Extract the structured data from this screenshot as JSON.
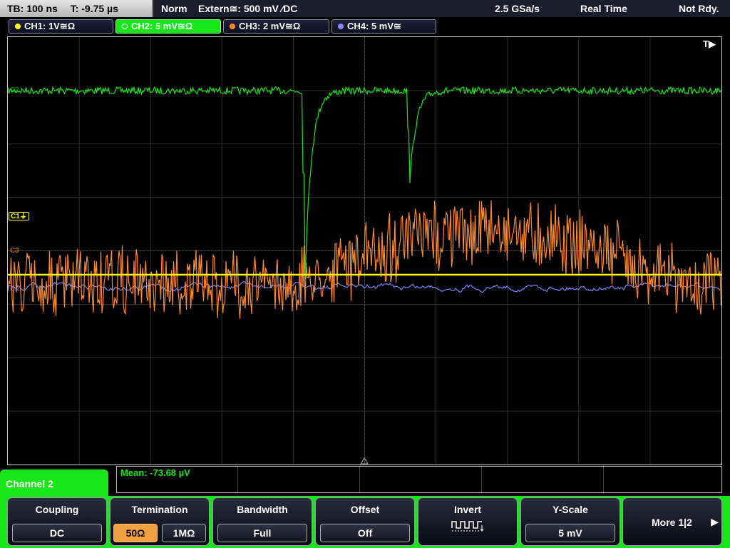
{
  "status": {
    "timebase": "TB: 100 ns",
    "trigger_time": "T: -9.75 µs",
    "mode": "Norm",
    "trigger": "Extern≅: 500 mV ⁄DC",
    "sample_rate": "2.5 GSa/s",
    "acquisition": "Real Time",
    "state": "Not Rdy."
  },
  "channels": [
    {
      "label": "CH1: 1V≅Ω",
      "color": "#ffff00",
      "active": false
    },
    {
      "label": "CH2: 5 mV≅Ω",
      "color": "#19e619",
      "active": true
    },
    {
      "label": "CH3: 2 mV≅Ω",
      "color": "#ff8a2a",
      "active": false
    },
    {
      "label": "CH4: 5 mV≅",
      "color": "#8a8aff",
      "active": false
    }
  ],
  "trigger_indicator": "T▶",
  "waveform_markers": {
    "ch1": "C1⏚",
    "ch2": "C2",
    "ch3": "C3",
    "ch4": "C4"
  },
  "measurement": {
    "mean": "Mean: -73.68 µV"
  },
  "menu": {
    "title": "Channel 2",
    "coupling": {
      "title": "Coupling",
      "value": "DC"
    },
    "termination": {
      "title": "Termination",
      "options": [
        "50Ω",
        "1MΩ"
      ],
      "selected": "50Ω"
    },
    "bandwidth": {
      "title": "Bandwidth",
      "value": "Full"
    },
    "offset": {
      "title": "Offset",
      "value": "Off"
    },
    "invert": {
      "title": "Invert",
      "icon": "square-wave-invert-icon"
    },
    "yscale": {
      "title": "Y-Scale",
      "value": "5 mV"
    },
    "more": {
      "label": "More 1|2"
    }
  }
}
